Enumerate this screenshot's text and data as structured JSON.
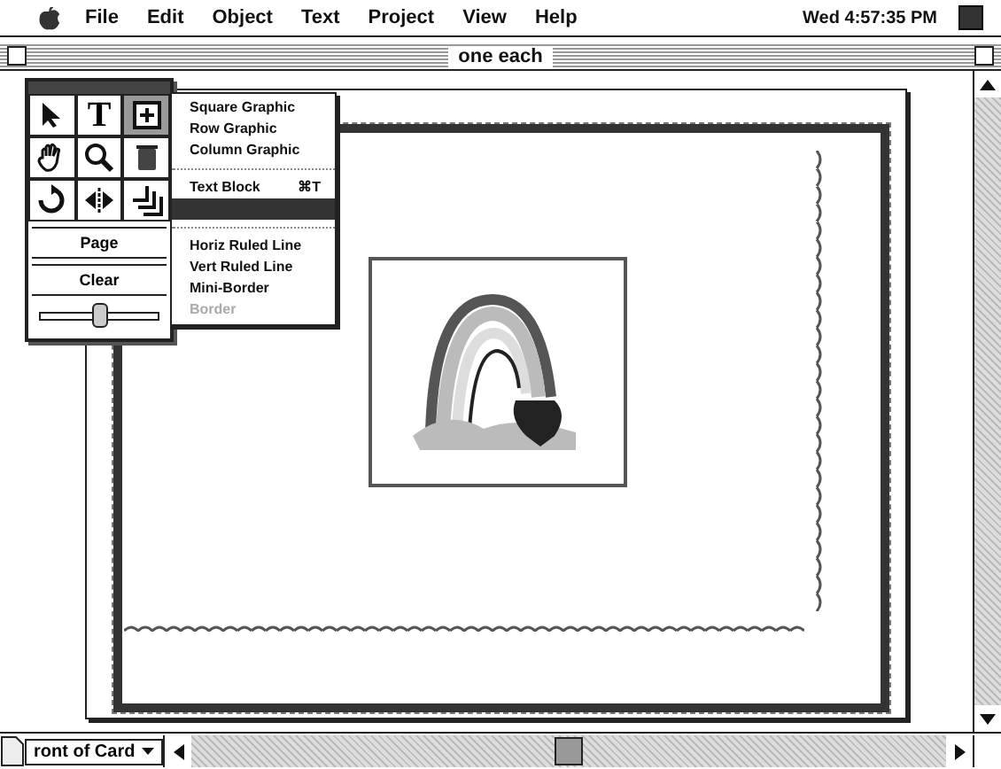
{
  "menubar": {
    "items": [
      "File",
      "Edit",
      "Object",
      "Text",
      "Project",
      "View",
      "Help"
    ],
    "clock": "Wed 4:57:35 PM"
  },
  "window": {
    "title": "one each"
  },
  "palette": {
    "tools": [
      {
        "kind": "pointer",
        "selected": false
      },
      {
        "kind": "text",
        "label": "T",
        "selected": false
      },
      {
        "kind": "graphic",
        "selected": true
      },
      {
        "kind": "hand",
        "selected": false
      },
      {
        "kind": "zoom",
        "selected": false
      },
      {
        "kind": "trash",
        "selected": false
      },
      {
        "kind": "rotate",
        "selected": false
      },
      {
        "kind": "flip",
        "selected": false
      },
      {
        "kind": "layers",
        "selected": false
      }
    ],
    "buttons": [
      "Page",
      "Clear"
    ],
    "slider": {
      "level": 0.5
    }
  },
  "menu": {
    "items": [
      {
        "kind": "item",
        "label": "Square Graphic",
        "disabled": false,
        "selected": false
      },
      {
        "kind": "item",
        "label": "Row Graphic",
        "disabled": false,
        "selected": false
      },
      {
        "kind": "item",
        "label": "Column Graphic",
        "disabled": false,
        "selected": false
      },
      {
        "kind": "separator"
      },
      {
        "kind": "item",
        "label": "Text Block",
        "shortcut": "⌘T",
        "disabled": false,
        "selected": false
      },
      {
        "kind": "item",
        "disabled": false,
        "selected": true
      },
      {
        "kind": "separator"
      },
      {
        "kind": "item",
        "label": "Horiz Ruled Line",
        "disabled": false,
        "selected": false
      },
      {
        "kind": "item",
        "label": "Vert Ruled Line",
        "disabled": false,
        "selected": false
      },
      {
        "kind": "item",
        "label": "Mini-Border",
        "disabled": false,
        "selected": false
      },
      {
        "kind": "item",
        "label": "Border",
        "disabled": true,
        "selected": false
      }
    ]
  },
  "footer": {
    "view_popup": "ront of Card"
  }
}
